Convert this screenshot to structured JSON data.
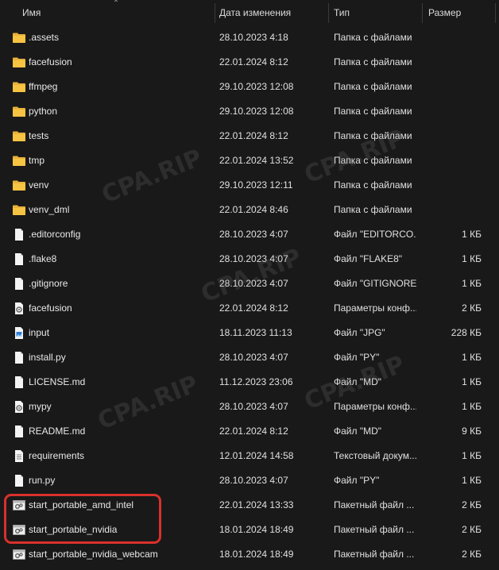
{
  "header": {
    "name": "Имя",
    "date": "Дата изменения",
    "type": "Тип",
    "size": "Размер"
  },
  "files": [
    {
      "icon": "folder-icon",
      "name": ".assets",
      "date": "28.10.2023 4:18",
      "type": "Папка с файлами",
      "size": ""
    },
    {
      "icon": "folder-icon",
      "name": "facefusion",
      "date": "22.01.2024 8:12",
      "type": "Папка с файлами",
      "size": ""
    },
    {
      "icon": "folder-icon",
      "name": "ffmpeg",
      "date": "29.10.2023 12:08",
      "type": "Папка с файлами",
      "size": ""
    },
    {
      "icon": "folder-icon",
      "name": "python",
      "date": "29.10.2023 12:08",
      "type": "Папка с файлами",
      "size": ""
    },
    {
      "icon": "folder-icon",
      "name": "tests",
      "date": "22.01.2024 8:12",
      "type": "Папка с файлами",
      "size": ""
    },
    {
      "icon": "folder-icon",
      "name": "tmp",
      "date": "22.01.2024 13:52",
      "type": "Папка с файлами",
      "size": ""
    },
    {
      "icon": "folder-icon",
      "name": "venv",
      "date": "29.10.2023 12:11",
      "type": "Папка с файлами",
      "size": ""
    },
    {
      "icon": "folder-icon",
      "name": "venv_dml",
      "date": "22.01.2024 8:46",
      "type": "Папка с файлами",
      "size": ""
    },
    {
      "icon": "file-icon",
      "name": ".editorconfig",
      "date": "28.10.2023 4:07",
      "type": "Файл \"EDITORCO...",
      "size": "1 КБ"
    },
    {
      "icon": "file-icon",
      "name": ".flake8",
      "date": "28.10.2023 4:07",
      "type": "Файл \"FLAKE8\"",
      "size": "1 КБ"
    },
    {
      "icon": "file-icon",
      "name": ".gitignore",
      "date": "28.10.2023 4:07",
      "type": "Файл \"GITIGNORE\"",
      "size": "1 КБ"
    },
    {
      "icon": "config-file-icon",
      "name": "facefusion",
      "date": "22.01.2024 8:12",
      "type": "Параметры конф...",
      "size": "2 КБ"
    },
    {
      "icon": "image-file-icon",
      "name": "input",
      "date": "18.11.2023 11:13",
      "type": "Файл \"JPG\"",
      "size": "228 КБ"
    },
    {
      "icon": "file-icon",
      "name": "install.py",
      "date": "28.10.2023 4:07",
      "type": "Файл \"PY\"",
      "size": "1 КБ"
    },
    {
      "icon": "file-icon",
      "name": "LICENSE.md",
      "date": "11.12.2023 23:06",
      "type": "Файл \"MD\"",
      "size": "1 КБ"
    },
    {
      "icon": "config-file-icon",
      "name": "mypy",
      "date": "28.10.2023 4:07",
      "type": "Параметры конф...",
      "size": "1 КБ"
    },
    {
      "icon": "file-icon",
      "name": "README.md",
      "date": "22.01.2024 8:12",
      "type": "Файл \"MD\"",
      "size": "9 КБ"
    },
    {
      "icon": "text-file-icon",
      "name": "requirements",
      "date": "12.01.2024 14:58",
      "type": "Текстовый докум...",
      "size": "1 КБ"
    },
    {
      "icon": "file-icon",
      "name": "run.py",
      "date": "28.10.2023 4:07",
      "type": "Файл \"PY\"",
      "size": "1 КБ"
    },
    {
      "icon": "batch-file-icon",
      "name": "start_portable_amd_intel",
      "date": "22.01.2024 13:33",
      "type": "Пакетный файл ...",
      "size": "2 КБ"
    },
    {
      "icon": "batch-file-icon",
      "name": "start_portable_nvidia",
      "date": "18.01.2024 18:49",
      "type": "Пакетный файл ...",
      "size": "2 КБ"
    },
    {
      "icon": "batch-file-icon",
      "name": "start_portable_nvidia_webcam",
      "date": "18.01.2024 18:49",
      "type": "Пакетный файл ...",
      "size": "2 КБ"
    }
  ],
  "watermark": "CPA.RIP",
  "colors": {
    "background": "#191919",
    "folder": "#f6c343",
    "highlight": "#d9302c"
  }
}
